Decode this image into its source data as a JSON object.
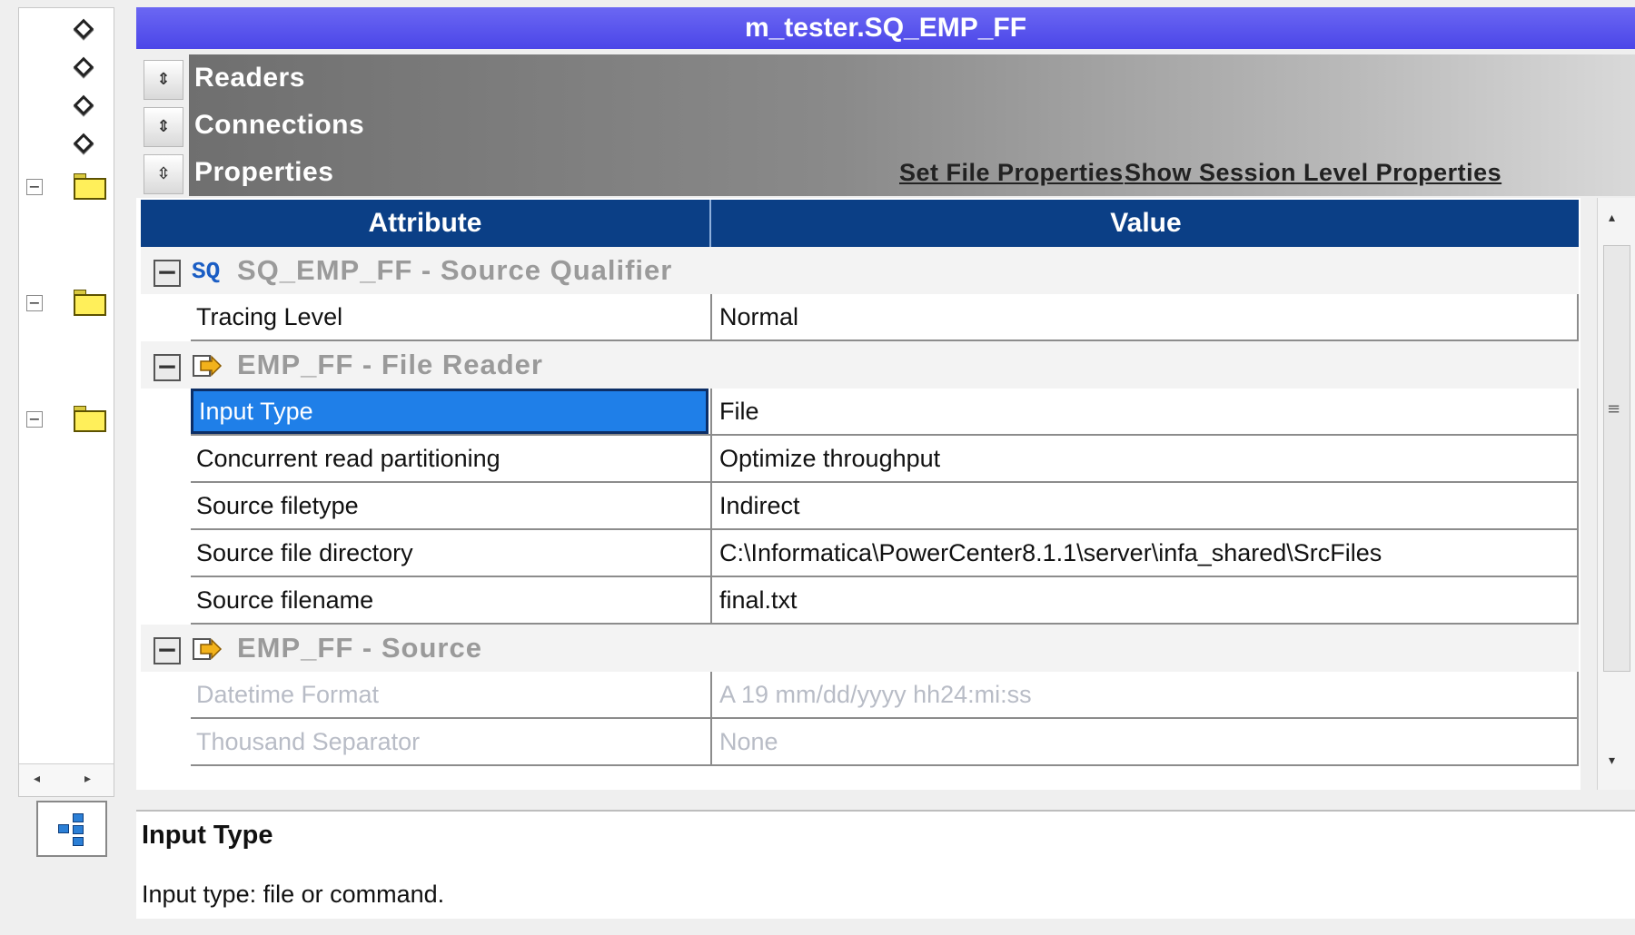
{
  "window_title": "m_tester.SQ_EMP_FF",
  "sections": {
    "readers": "Readers",
    "connections": "Connections",
    "properties": "Properties",
    "set_file_properties": "Set File Properties",
    "show_session_level_properties": "Show Session Level Properties"
  },
  "grid": {
    "header_attribute": "Attribute",
    "header_value": "Value",
    "groups": [
      {
        "badge": "SQ",
        "label": "SQ_EMP_FF - Source Qualifier",
        "rows": [
          {
            "attribute": "Tracing Level",
            "value": "Normal"
          }
        ]
      },
      {
        "label": "EMP_FF - File Reader",
        "rows": [
          {
            "attribute": "Input Type",
            "value": "File",
            "selected": true
          },
          {
            "attribute": "Concurrent read partitioning",
            "value": "Optimize throughput"
          },
          {
            "attribute": "Source filetype",
            "value": "Indirect"
          },
          {
            "attribute": "Source file directory",
            "value": "C:\\Informatica\\PowerCenter8.1.1\\server\\infa_shared\\SrcFiles"
          },
          {
            "attribute": "Source filename",
            "value": "final.txt"
          }
        ]
      },
      {
        "label": "EMP_FF - Source",
        "rows": [
          {
            "attribute": "Datetime Format",
            "value": "A 19 mm/dd/yyyy hh24:mi:ss",
            "disabled": true
          },
          {
            "attribute": "Thousand Separator",
            "value": "None",
            "disabled": true
          }
        ]
      }
    ]
  },
  "description": {
    "title": "Input Type",
    "text": "Input type: file or command."
  },
  "colors": {
    "title_bar": "#5753ee",
    "grid_header": "#0b3f86",
    "selection": "#1f7fe8"
  }
}
